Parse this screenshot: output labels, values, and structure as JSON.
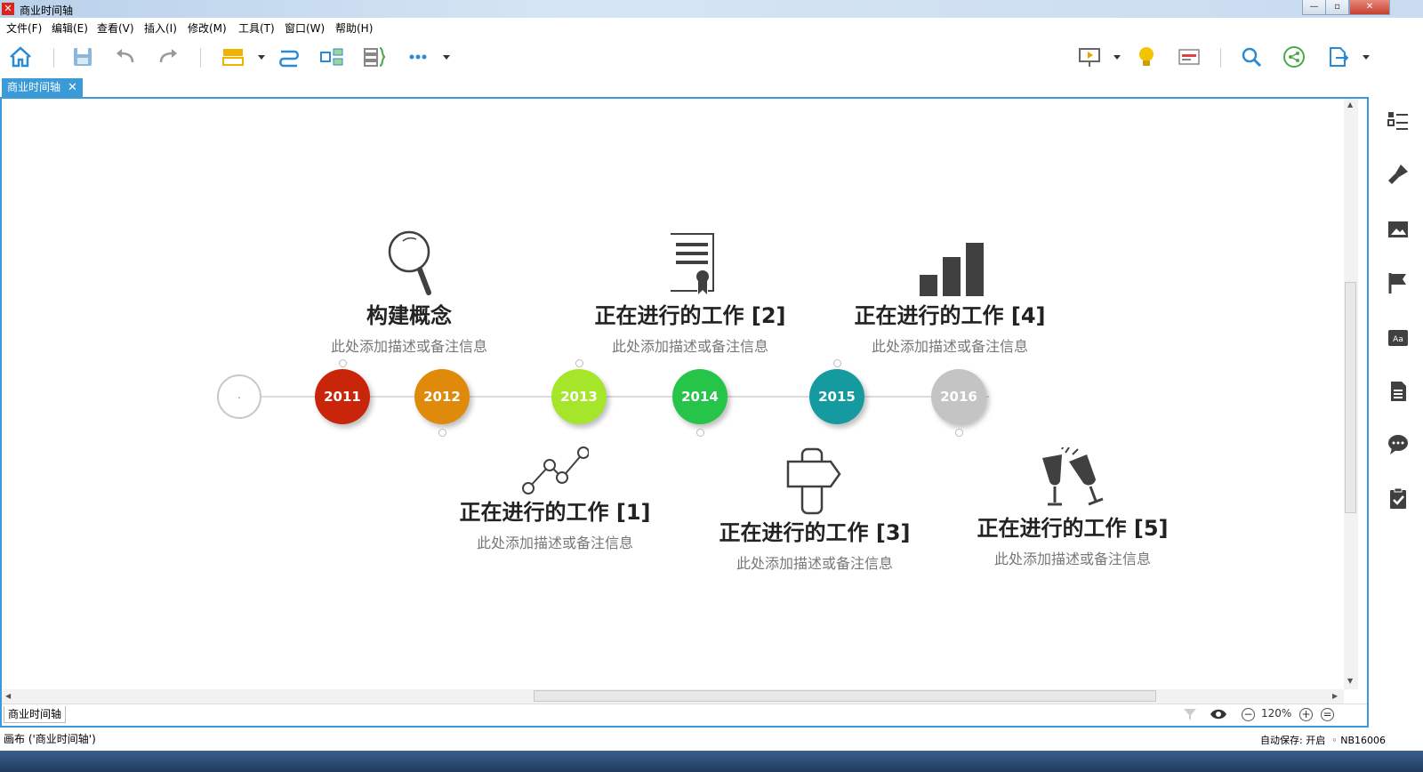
{
  "window": {
    "title": "商业时间轴",
    "logo_glyph": "✕",
    "min": "—",
    "max": "▫",
    "close": "✕"
  },
  "menu": [
    "文件(F)",
    "编辑(E)",
    "查看(V)",
    "插入(I)",
    "修改(M)",
    "工具(T)",
    "窗口(W)",
    "帮助(H)"
  ],
  "toolbar": {
    "icons": [
      "home-icon",
      "save-icon",
      "undo-icon",
      "redo-icon",
      "topic-icon",
      "relationship-icon",
      "summary-icon",
      "boundary-icon",
      "more-icon",
      "presentation-icon",
      "idea-icon",
      "gantt-icon",
      "search-icon",
      "share-icon",
      "export-icon"
    ]
  },
  "tab": {
    "label": "商业时间轴",
    "close": "✕"
  },
  "colors": {
    "accent": "#3a9bd8",
    "y2011": "#c9250a",
    "y2012": "#df8a0a",
    "y2013": "#a5e62a",
    "y2014": "#27c44a",
    "y2015": "#159b9f",
    "y2016": "#c4c4c4",
    "icon": "#404040"
  },
  "timeline": {
    "start_label": "·",
    "years": [
      "2011",
      "2012",
      "2013",
      "2014",
      "2015",
      "2016"
    ],
    "topics": [
      {
        "title": "构建概念",
        "desc": "此处添加描述或备注信息",
        "icon": "magnifier-icon"
      },
      {
        "title": "正在进行的工作 [1]",
        "desc": "此处添加描述或备注信息",
        "icon": "line-chart-icon"
      },
      {
        "title": "正在进行的工作 [2]",
        "desc": "此处添加描述或备注信息",
        "icon": "certificate-icon"
      },
      {
        "title": "正在进行的工作 [3]",
        "desc": "此处添加描述或备注信息",
        "icon": "signpost-icon"
      },
      {
        "title": "正在进行的工作 [4]",
        "desc": "此处添加描述或备注信息",
        "icon": "bar-chart-icon"
      },
      {
        "title": "正在进行的工作 [5]",
        "desc": "此处添加描述或备注信息",
        "icon": "champagne-icon"
      }
    ]
  },
  "sheet": {
    "tab_label": "商业时间轴",
    "zoom": "120%"
  },
  "sidepanel": {
    "icons": [
      "outline-icon",
      "format-brush-icon",
      "image-icon",
      "flag-icon",
      "text-style-icon",
      "notes-icon",
      "comment-icon",
      "task-icon"
    ]
  },
  "status": {
    "canvas": "画布 ('商业时间轴')",
    "autosave": "自动保存: 开启",
    "user": "NB16006"
  }
}
